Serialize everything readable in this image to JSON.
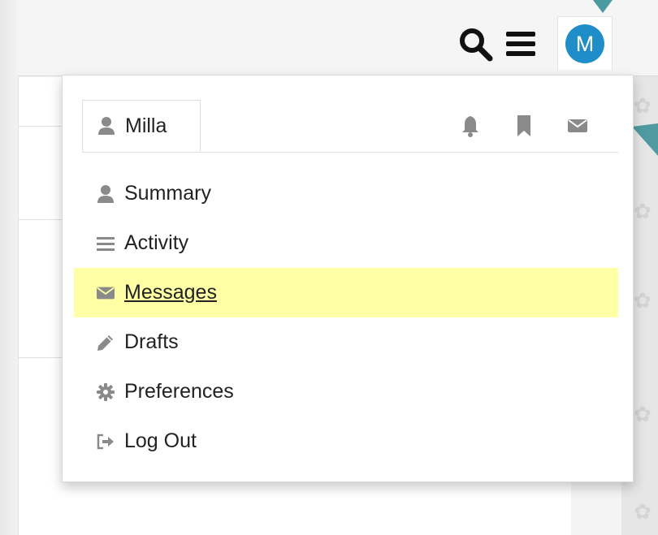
{
  "header": {
    "search_icon": "search-icon",
    "menu_icon": "hamburger-icon",
    "avatar_letter": "M",
    "avatar_color": "#1f8ec8"
  },
  "user_panel": {
    "tab_label": "Milla",
    "tab_icons": [
      "bell-icon",
      "bookmark-icon",
      "envelope-icon"
    ],
    "items": [
      {
        "label": "Summary",
        "icon": "user-icon",
        "active": false
      },
      {
        "label": "Activity",
        "icon": "list-icon",
        "active": false
      },
      {
        "label": "Messages",
        "icon": "envelope-icon",
        "active": true
      },
      {
        "label": "Drafts",
        "icon": "pencil-icon",
        "active": false
      },
      {
        "label": "Preferences",
        "icon": "cog-icon",
        "active": false
      },
      {
        "label": "Log Out",
        "icon": "sign-out-icon",
        "active": false
      }
    ]
  },
  "colors": {
    "highlight": "#ffffa6",
    "accent": "#1f8ec8",
    "icon_gray": "#8a8a8a"
  }
}
